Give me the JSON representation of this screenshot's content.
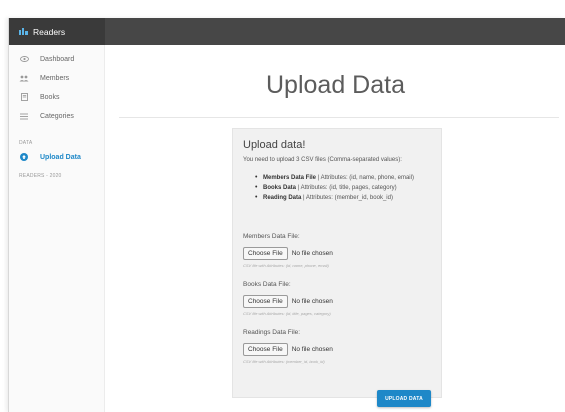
{
  "app": {
    "title": "Readers",
    "brand_color": "#474747",
    "accent_color": "#1e88c8"
  },
  "sidebar": {
    "items": [
      {
        "label": "Dashboard",
        "icon": "eye-icon",
        "active": false
      },
      {
        "label": "Members",
        "icon": "users-icon",
        "active": false
      },
      {
        "label": "Books",
        "icon": "book-icon",
        "active": false
      },
      {
        "label": "Categories",
        "icon": "list-icon",
        "active": false
      }
    ],
    "section_heading": "DATA",
    "data_items": [
      {
        "label": "Upload Data",
        "icon": "upload-circle-icon",
        "active": true
      }
    ],
    "footer": "READERS - 2020"
  },
  "main": {
    "title": "Upload Data",
    "card": {
      "title": "Upload data!",
      "description": "You need to upload 3 CSV files (Comma-separated values):",
      "requirements": [
        {
          "name": "Members Data File",
          "attrs": " | Attributes: (id, name, phone, email)"
        },
        {
          "name": "Books Data",
          "attrs": " | Attributes: (id, title, pages, category)"
        },
        {
          "name": "Reading Data",
          "attrs": " | Attributes: (member_id, book_id)"
        }
      ],
      "fields": [
        {
          "label": "Members Data File:",
          "button": "Choose File",
          "status": "No file chosen",
          "hint": "CSV file with Attributes: (id, name, phone, email)"
        },
        {
          "label": "Books Data File:",
          "button": "Choose File",
          "status": "No file chosen",
          "hint": "CSV file with Attributes: (id, title, pages, category)"
        },
        {
          "label": "Readings Data File:",
          "button": "Choose File",
          "status": "No file chosen",
          "hint": "CSV file with Attributes: (member_id, book_id)"
        }
      ],
      "submit_label": "UPLOAD DATA"
    }
  }
}
